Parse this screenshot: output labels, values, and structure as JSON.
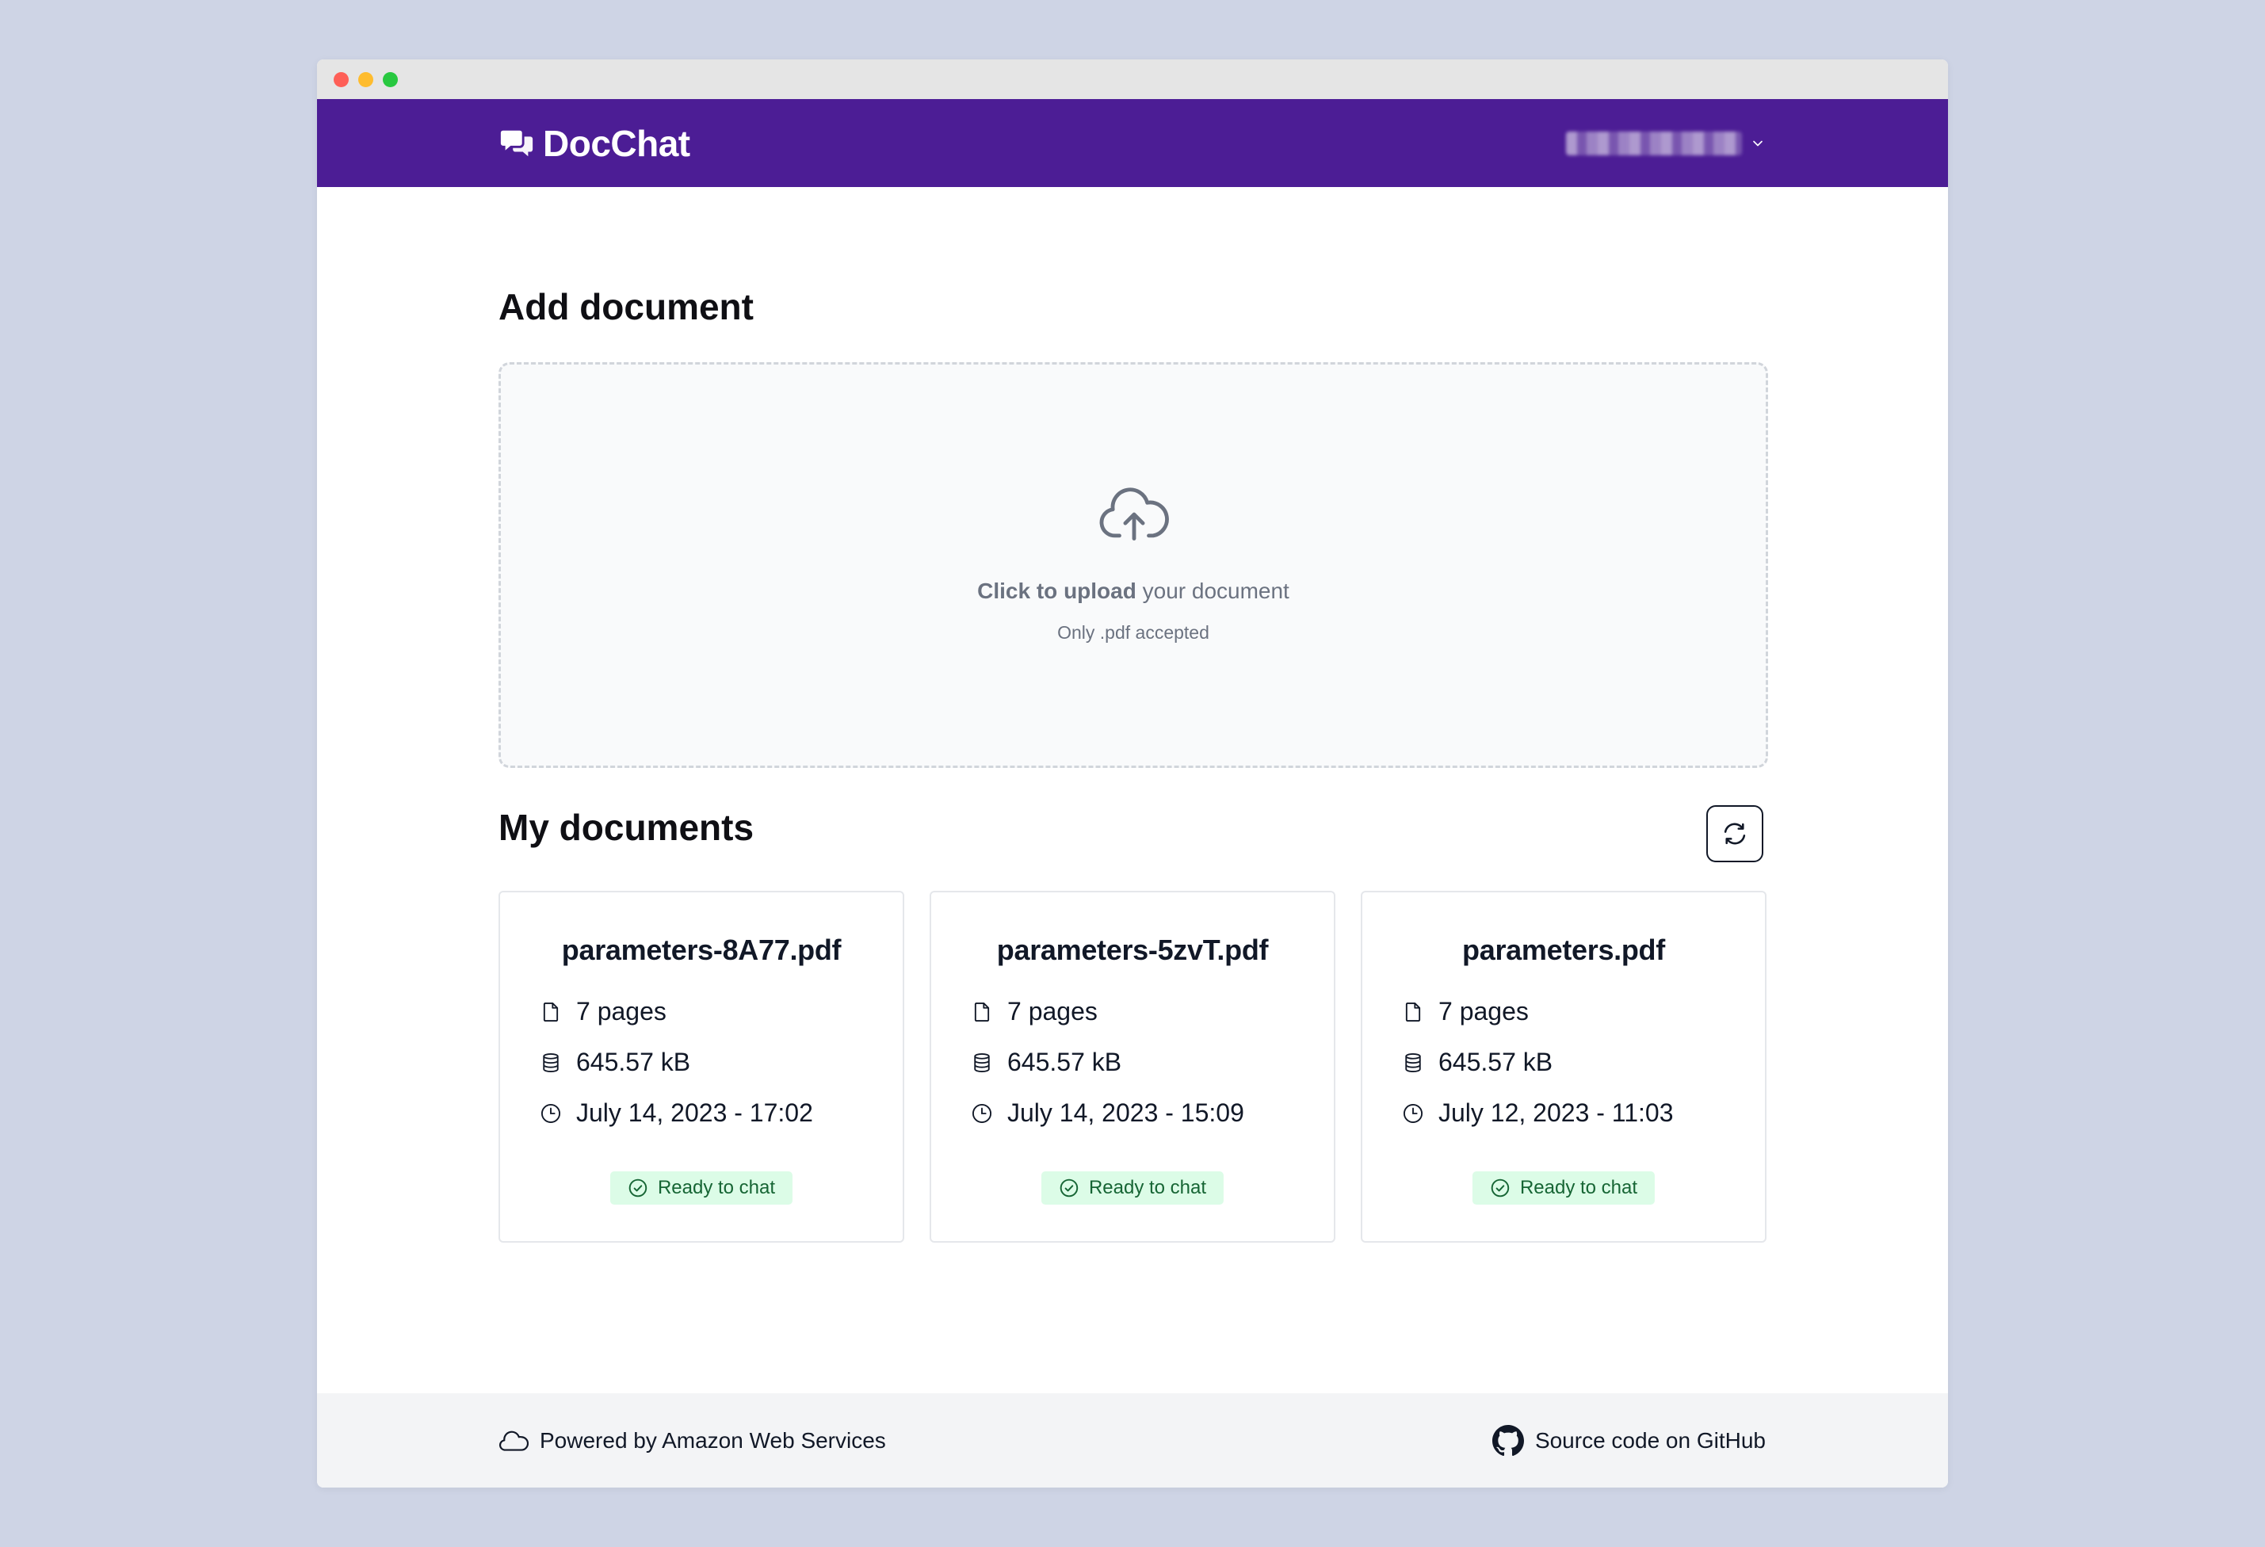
{
  "window": {
    "controls": [
      "close",
      "minimize",
      "maximize"
    ]
  },
  "header": {
    "app_name": "DocChat",
    "logo_icon": "chat-bubbles-icon",
    "user_icon": "chevron-down-icon",
    "bg_color": "#4c1d95"
  },
  "add_section": {
    "title": "Add document",
    "upload_bold": "Click to upload",
    "upload_rest": " your document",
    "upload_hint": "Only .pdf accepted",
    "icon": "cloud-upload-icon"
  },
  "documents_section": {
    "title": "My documents",
    "refresh_icon": "refresh-icon",
    "items": [
      {
        "name": "parameters-8A77.pdf",
        "pages": "7 pages",
        "size": "645.57 kB",
        "date": "July 14, 2023 - 17:02",
        "status": "Ready to chat"
      },
      {
        "name": "parameters-5zvT.pdf",
        "pages": "7 pages",
        "size": "645.57 kB",
        "date": "July 14, 2023 - 15:09",
        "status": "Ready to chat"
      },
      {
        "name": "parameters.pdf",
        "pages": "7 pages",
        "size": "645.57 kB",
        "date": "July 12, 2023 - 11:03",
        "status": "Ready to chat"
      }
    ],
    "status_color": "#166534",
    "status_bg": "#dcfce7"
  },
  "footer": {
    "left_text": "Powered by Amazon Web Services",
    "left_icon": "cloud-icon",
    "right_text": "Source code on GitHub",
    "right_icon": "github-icon"
  }
}
